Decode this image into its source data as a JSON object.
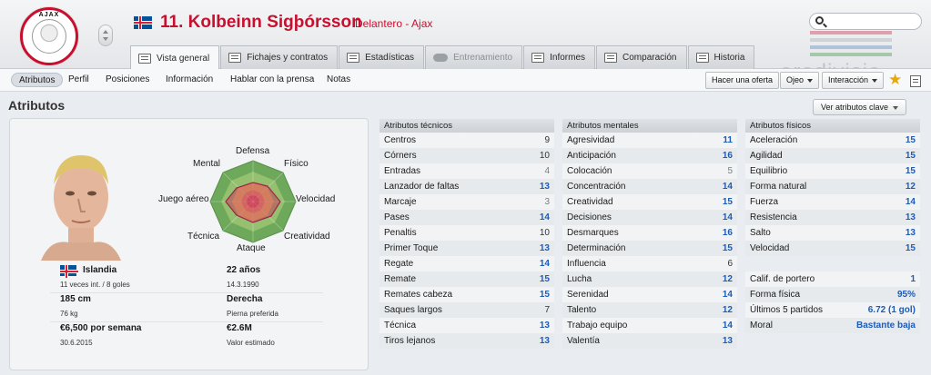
{
  "header": {
    "club_crest_text": "AJAX",
    "player_name": "11. Kolbeinn Sigþórsson",
    "player_role": "Delantero - Ajax",
    "league_logo_text": "eredivisie",
    "search_placeholder": ""
  },
  "tabs": [
    {
      "label": "Vista general",
      "state": "active"
    },
    {
      "label": "Fichajes y contratos",
      "state": "normal"
    },
    {
      "label": "Estadísticas",
      "state": "normal"
    },
    {
      "label": "Entrenamiento",
      "state": "disabled"
    },
    {
      "label": "Informes",
      "state": "normal"
    },
    {
      "label": "Comparación",
      "state": "normal"
    },
    {
      "label": "Historia",
      "state": "normal"
    }
  ],
  "subnav": {
    "items": [
      "Atributos",
      "Perfil",
      "Posiciones",
      "Información",
      "Hablar con la prensa",
      "Notas"
    ],
    "offer_button": "Hacer una oferta",
    "scout_button": "Ojeo",
    "interaction_button": "Interacción"
  },
  "section": {
    "title": "Atributos",
    "key_attributes_button": "Ver atributos clave"
  },
  "player_info": {
    "nation": "Islandia",
    "caps": "11 veces int. / 8 goles",
    "age": "22 años",
    "dob": "14.3.1990",
    "height": "185 cm",
    "weight": "76 kg",
    "foot": "Derecha",
    "foot_label": "Pierna preferida",
    "wage": "€6,500 por semana",
    "contract_end": "30.6.2015",
    "value": "€2.6M",
    "value_label": "Valor estimado"
  },
  "radar": {
    "labels": {
      "top": "Defensa",
      "top_left": "Mental",
      "top_right": "Físico",
      "left": "Juego aéreo",
      "right": "Velocidad",
      "bottom_left": "Técnica",
      "bottom_right": "Creatividad",
      "bottom": "Ataque"
    }
  },
  "attributes": {
    "technical": {
      "header": "Atributos técnicos",
      "rows": [
        {
          "name": "Centros",
          "value": "9",
          "style": "dark"
        },
        {
          "name": "Córners",
          "value": "10",
          "style": "dark"
        },
        {
          "name": "Entradas",
          "value": "4",
          "style": "gray"
        },
        {
          "name": "Lanzador de faltas",
          "value": "13",
          "style": "blue"
        },
        {
          "name": "Marcaje",
          "value": "3",
          "style": "gray"
        },
        {
          "name": "Pases",
          "value": "14",
          "style": "blue"
        },
        {
          "name": "Penaltis",
          "value": "10",
          "style": "dark"
        },
        {
          "name": "Primer Toque",
          "value": "13",
          "style": "blue"
        },
        {
          "name": "Regate",
          "value": "14",
          "style": "blue"
        },
        {
          "name": "Remate",
          "value": "15",
          "style": "blue"
        },
        {
          "name": "Remates cabeza",
          "value": "15",
          "style": "blue"
        },
        {
          "name": "Saques largos",
          "value": "7",
          "style": "dark"
        },
        {
          "name": "Técnica",
          "value": "13",
          "style": "blue"
        },
        {
          "name": "Tiros lejanos",
          "value": "13",
          "style": "blue"
        }
      ]
    },
    "mental": {
      "header": "Atributos mentales",
      "rows": [
        {
          "name": "Agresividad",
          "value": "11",
          "style": "blue"
        },
        {
          "name": "Anticipación",
          "value": "16",
          "style": "blue"
        },
        {
          "name": "Colocación",
          "value": "5",
          "style": "gray"
        },
        {
          "name": "Concentración",
          "value": "14",
          "style": "blue"
        },
        {
          "name": "Creatividad",
          "value": "15",
          "style": "blue"
        },
        {
          "name": "Decisiones",
          "value": "14",
          "style": "blue"
        },
        {
          "name": "Desmarques",
          "value": "16",
          "style": "blue"
        },
        {
          "name": "Determinación",
          "value": "15",
          "style": "blue"
        },
        {
          "name": "Influencia",
          "value": "6",
          "style": "dark"
        },
        {
          "name": "Lucha",
          "value": "12",
          "style": "blue"
        },
        {
          "name": "Serenidad",
          "value": "14",
          "style": "blue"
        },
        {
          "name": "Talento",
          "value": "12",
          "style": "blue"
        },
        {
          "name": "Trabajo equipo",
          "value": "14",
          "style": "blue"
        },
        {
          "name": "Valentía",
          "value": "13",
          "style": "blue"
        }
      ]
    },
    "physical": {
      "header": "Atributos físicos",
      "rows": [
        {
          "name": "Aceleración",
          "value": "15",
          "style": "blue"
        },
        {
          "name": "Agilidad",
          "value": "15",
          "style": "blue"
        },
        {
          "name": "Equilibrio",
          "value": "15",
          "style": "blue"
        },
        {
          "name": "Forma natural",
          "value": "12",
          "style": "blue"
        },
        {
          "name": "Fuerza",
          "value": "14",
          "style": "blue"
        },
        {
          "name": "Resistencia",
          "value": "13",
          "style": "blue"
        },
        {
          "name": "Salto",
          "value": "13",
          "style": "blue"
        },
        {
          "name": "Velocidad",
          "value": "15",
          "style": "blue"
        }
      ],
      "extra": [
        {
          "name": "Calif. de portero",
          "value": "1"
        },
        {
          "name": "Forma física",
          "value": "95%"
        },
        {
          "name": "Últimos 5 partidos",
          "value": "6.72 (1 gol)"
        },
        {
          "name": "Moral",
          "value": "Bastante baja"
        }
      ]
    }
  },
  "colors": {
    "brand_red": "#c8102e",
    "attr_blue": "#1c5bb8",
    "star": "#e8a80c"
  }
}
